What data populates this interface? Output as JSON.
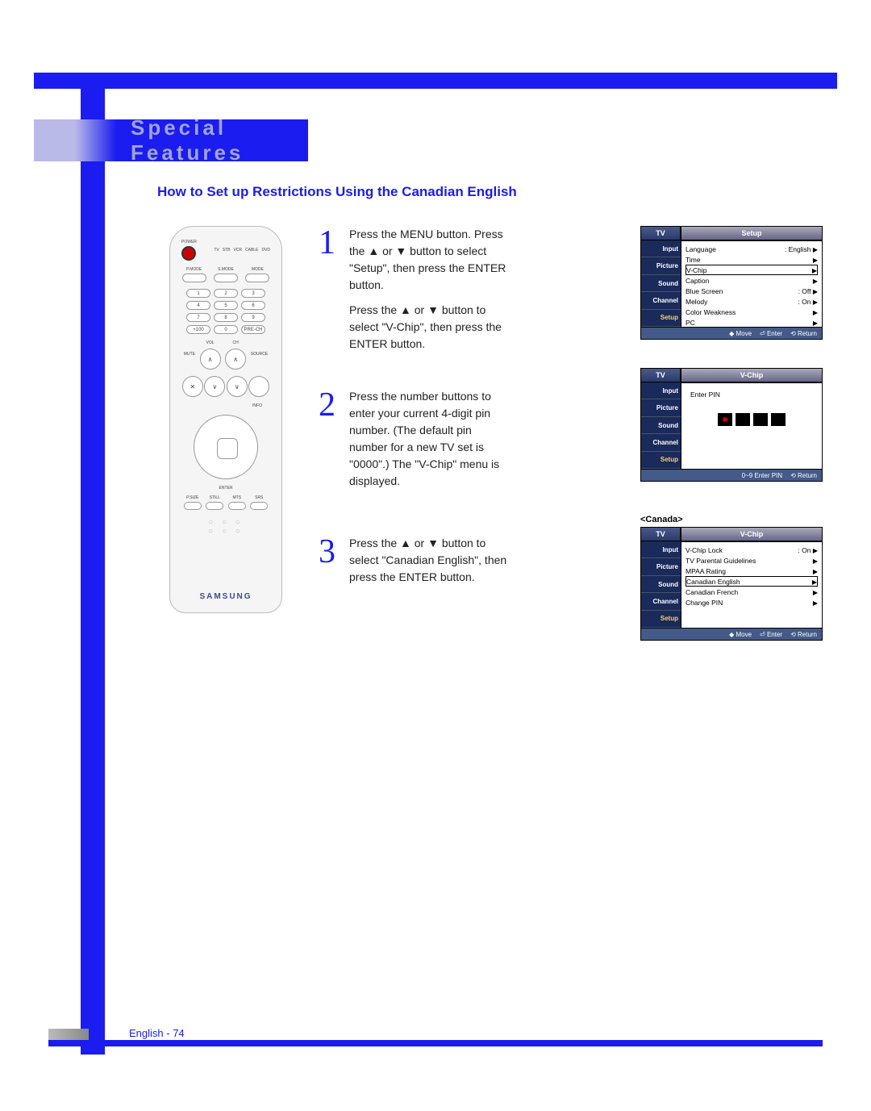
{
  "header": {
    "title": "Special Features"
  },
  "subtitle": "How to Set up Restrictions Using the Canadian English",
  "remote": {
    "power_label": "POWER",
    "dev_labels": [
      "TV",
      "STB",
      "VCR",
      "CABLE",
      "DVD"
    ],
    "mode_labels": [
      "P.MODE",
      "S.MODE",
      "MODE"
    ],
    "num_buttons": [
      "1",
      "2",
      "3",
      "4",
      "5",
      "6",
      "7",
      "8",
      "9",
      "+100",
      "0",
      "PRE-CH"
    ],
    "vol": "VOL",
    "ch": "CH",
    "mute": "MUTE",
    "source": "SOURCE",
    "info": "INFO",
    "bottom_labels": [
      "P.SIZE",
      "STILL",
      "MTS",
      "SRS"
    ],
    "brand": "SAMSUNG",
    "enter": "ENTER"
  },
  "steps": [
    {
      "num": "1",
      "paragraphs": [
        "Press the MENU button. Press the ▲ or ▼ button to select \"Setup\", then press the ENTER button.",
        "Press the ▲ or ▼ button to select \"V-Chip\", then press the ENTER button."
      ]
    },
    {
      "num": "2",
      "paragraphs": [
        "Press the number buttons to enter your current 4-digit pin number.\n(The default pin number for a new TV set is \"0000\".) The \"V-Chip\" menu is displayed."
      ]
    },
    {
      "num": "3",
      "paragraphs": [
        "Press the ▲ or ▼ button to select \"Canadian English\", then press the ENTER button."
      ]
    }
  ],
  "osd_common": {
    "tv": "TV",
    "tabs": [
      "Input",
      "Picture",
      "Sound",
      "Channel",
      "Setup"
    ],
    "foot_move": "◆ Move",
    "foot_enter": "⏎ Enter",
    "foot_return": "⟲ Return",
    "foot_pin": "0~9 Enter PIN"
  },
  "osd1": {
    "title": "Setup",
    "rows": [
      {
        "label": "Language",
        "value": ": English",
        "arrow": "▶"
      },
      {
        "label": "Time",
        "value": "",
        "arrow": "▶"
      },
      {
        "label": "V-Chip",
        "value": "",
        "arrow": "▶",
        "hl": true
      },
      {
        "label": "Caption",
        "value": "",
        "arrow": "▶"
      },
      {
        "label": "Blue Screen",
        "value": ": Off",
        "arrow": "▶"
      },
      {
        "label": "Melody",
        "value": ": On",
        "arrow": "▶"
      },
      {
        "label": "Color Weakness",
        "value": "",
        "arrow": "▶"
      },
      {
        "label": "PC",
        "value": "",
        "arrow": "▶"
      }
    ]
  },
  "osd2": {
    "title": "V-Chip",
    "enter_pin": "Enter PIN"
  },
  "osd3": {
    "canada": "<Canada>",
    "title": "V-Chip",
    "rows": [
      {
        "label": "V-Chip Lock",
        "value": ": On",
        "arrow": "▶"
      },
      {
        "label": "TV Parental Guidelines",
        "value": "",
        "arrow": "▶"
      },
      {
        "label": "MPAA Rating",
        "value": "",
        "arrow": "▶"
      },
      {
        "label": "Canadian English",
        "value": "",
        "arrow": "▶",
        "hl": true
      },
      {
        "label": "Canadian French",
        "value": "",
        "arrow": "▶"
      },
      {
        "label": "Change PIN",
        "value": "",
        "arrow": "▶"
      }
    ]
  },
  "footer": {
    "text": "English - 74"
  }
}
